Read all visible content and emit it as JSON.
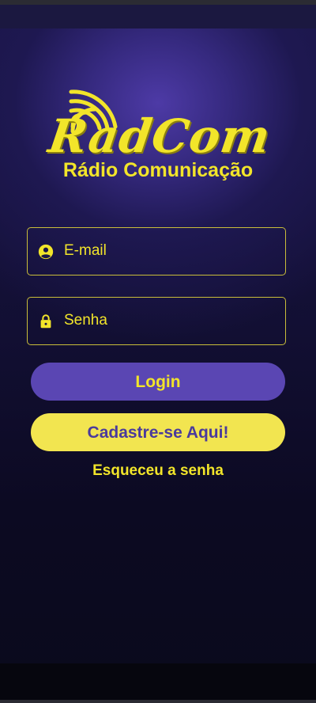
{
  "logo": {
    "wordmark": "RadCom",
    "subtitle": "Rádio Comunicação"
  },
  "form": {
    "email_placeholder": "E-mail",
    "password_placeholder": "Senha"
  },
  "buttons": {
    "login_label": "Login",
    "signup_label": "Cadastre-se Aqui!"
  },
  "links": {
    "forgot_password": "Esqueceu a senha"
  },
  "icons": {
    "email": "account-circle-icon",
    "password": "lock-icon",
    "logo": "radio-waves-icon"
  },
  "colors": {
    "accent_yellow": "#f2e52a",
    "button_purple": "#5a46b3",
    "background_dark": "#0b0a1c"
  }
}
